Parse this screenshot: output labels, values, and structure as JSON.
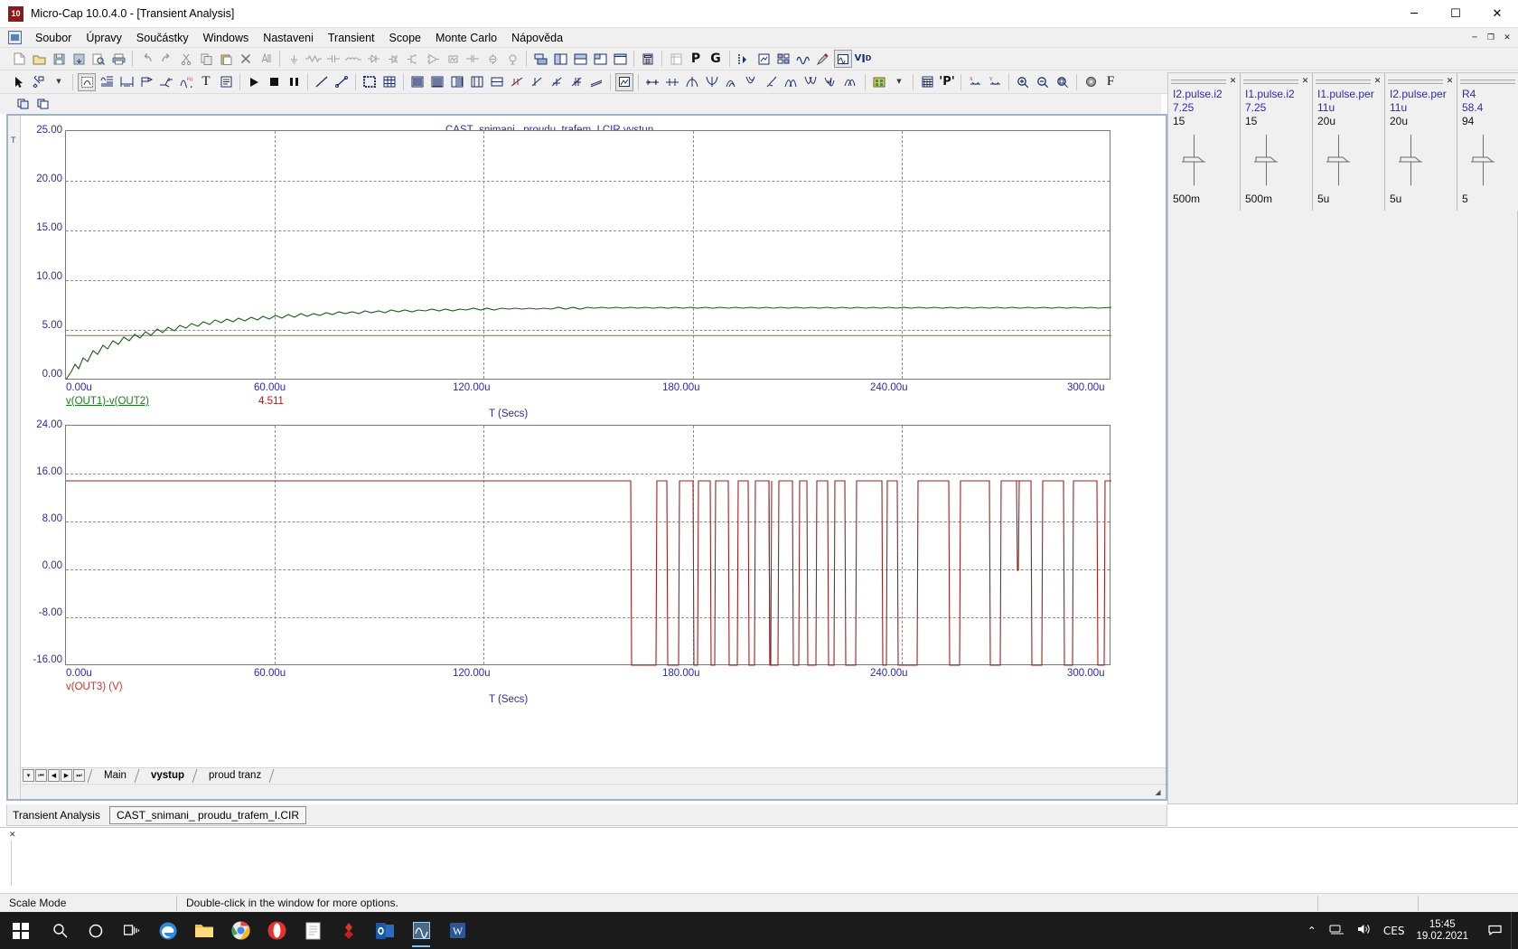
{
  "window": {
    "app_icon_label": "10",
    "title": "Micro-Cap 10.0.4.0 - [Transient Analysis]",
    "minimize": "─",
    "maximize": "☐",
    "close": "✕",
    "mdi_minimize": "─",
    "mdi_restore": "❐",
    "mdi_close": "✕"
  },
  "menu": {
    "items": [
      "Soubor",
      "Úpravy",
      "Součástky",
      "Windows",
      "Nastaveni",
      "Transient",
      "Scope",
      "Monte Carlo",
      "Nápověda"
    ]
  },
  "toolbar1": {
    "groups": [
      [
        "new-file-icon",
        "open-folder-icon",
        "save-icon",
        "save-all-icon",
        "print-preview-icon",
        "print-icon"
      ],
      [
        "undo-icon",
        "redo-icon",
        "cut-icon",
        "copy-icon",
        "paste-icon",
        "delete-icon",
        "select-all-icon"
      ],
      [
        "ground-icon",
        "resistor-icon",
        "capacitor-icon",
        "inductor-icon",
        "diode-icon",
        "jfet-icon",
        "transistor-icon",
        "opamp-icon",
        "source-icon",
        "node-icon",
        "probe-icon",
        "meter-icon"
      ],
      [
        "tile-icon",
        "split-vertical-icon",
        "split-horizontal-icon",
        "cascade-icon",
        "maximize-window-icon",
        "calculator-icon"
      ],
      [
        "table-icon",
        "p-label-icon",
        "g-label-icon"
      ],
      [
        "node-number-icon",
        "page-icon",
        "grid-values-icon",
        "waveform-icon",
        "marker-pen-icon",
        "circuit-window-icon",
        "vid-icon"
      ]
    ]
  },
  "toolbar2": {
    "groups": [
      [
        "arrow-select-icon",
        "component-icon",
        "dropdown-arrow-icon"
      ],
      [
        "wire-mode-icon",
        "text-graph-icon",
        "bus-icon",
        "flag-icon",
        "scale-icon",
        "function-icon",
        "text-icon",
        "properties-icon"
      ],
      [
        "run-icon",
        "stop-icon",
        "pause-icon"
      ],
      [
        "line-icon",
        "line-node-icon"
      ],
      [
        "box-icon",
        "grid-icon"
      ],
      [
        "bars-icon",
        "rows-icon",
        "columns-icon",
        "table2-icon",
        "window-icon",
        "cursor-mode-icon"
      ],
      [
        "peak-icon",
        "valley-icon",
        "highlow-icon",
        "slope-icon"
      ],
      [
        "thumbnail-icon"
      ],
      [
        "horiz-cursor-icon",
        "vert-cursor-icon",
        "peak-wave-icon",
        "valley-wave-icon",
        "rise-wave-icon",
        "fall-wave-icon",
        "slope-wave-icon",
        "inflection-wave-icon",
        "bottom-wave-icon",
        "global-wave-icon",
        "top-wave-icon"
      ],
      [
        "palette-icon",
        "palette-arrow-icon"
      ],
      [
        "numeric-output-icon"
      ],
      [
        "performance-p-icon"
      ],
      [
        "x-axis-icon",
        "y-axis-icon"
      ],
      [
        "zoom-in-icon",
        "zoom-out-icon",
        "zoom-fit-icon"
      ],
      [
        "color-wheel-icon",
        "font-f-icon"
      ]
    ]
  },
  "toolbar3": {
    "buttons": [
      "copy-window-icon",
      "paste-window-icon"
    ]
  },
  "plot_window": {
    "left_strip_mark": "T",
    "subtools": [
      "copy-plot-icon",
      "paste-plot-icon"
    ]
  },
  "page_tabs": {
    "nav": [
      "▾",
      "⏮",
      "◀",
      "▶",
      "⏭"
    ],
    "tabs": [
      {
        "label": "Main",
        "active": false
      },
      {
        "label": "vystup",
        "active": true
      },
      {
        "label": "proud tranz",
        "active": false
      }
    ]
  },
  "analysis_bar": {
    "label": "Transient Analysis",
    "file_tab": "CAST_snimani_ proudu_trafem_I.CIR"
  },
  "statusbar": {
    "mode": "Scale Mode",
    "hint": "Double-click in the window for more options."
  },
  "sliders": {
    "panels": [
      {
        "name": "I2.pulse.i2",
        "value": "7.25",
        "max": "15",
        "min": "500m",
        "close": "✕"
      },
      {
        "name": "I1.pulse.i2",
        "value": "7.25",
        "max": "15",
        "min": "500m",
        "close": "✕"
      },
      {
        "name": "I1.pulse.per",
        "value": "11u",
        "max": "20u",
        "min": "5u",
        "close": "✕"
      },
      {
        "name": "I2.pulse.per",
        "value": "11u",
        "max": "20u",
        "min": "5u",
        "close": "✕"
      },
      {
        "name": "R4",
        "value": "58.4",
        "max": "94",
        "min": "5",
        "close": "✕"
      }
    ]
  },
  "taskbar": {
    "start": "start-icon",
    "icons": [
      "search-icon",
      "cortana-icon",
      "task-view-icon",
      "edge-icon",
      "file-explorer-icon",
      "chrome-icon",
      "opera-icon",
      "notepad-icon",
      "mathcad-icon",
      "outlook-icon",
      "microcap-icon",
      "word-icon"
    ],
    "tray": {
      "chevron": "⌃",
      "network": "network-icon",
      "volume": "volume-icon",
      "language": "CES",
      "time": "15:45",
      "date": "19.02.2021",
      "notification": "notification-icon"
    }
  },
  "chart_data": [
    {
      "type": "line",
      "title": "CAST_snimani_ proudu_trafem_I.CIR vystup",
      "xlabel": "T (Secs)",
      "ylabel": "",
      "yticks": [
        "25.00",
        "20.00",
        "15.00",
        "10.00",
        "5.00",
        "0.00"
      ],
      "yvalues": [
        25,
        20,
        15,
        10,
        5,
        0
      ],
      "ylim": [
        0,
        25
      ],
      "xticks": [
        "0.00u",
        "60.00u",
        "120.00u",
        "180.00u",
        "240.00u",
        "300.00u"
      ],
      "xvalues": [
        0,
        60,
        120,
        180,
        240,
        300
      ],
      "xlim": [
        0,
        300
      ],
      "grid": true,
      "legend": [
        {
          "label": "v(OUT1)-v(OUT2)",
          "color": "#1e7a1e"
        },
        {
          "label": "4.511",
          "color": "#b01818"
        }
      ],
      "series": [
        {
          "name": "v(OUT1)-v(OUT2)",
          "color": "#1e5b1e",
          "x": [
            0,
            5,
            10,
            15,
            20,
            25,
            30,
            35,
            40,
            45,
            50,
            60,
            70,
            80,
            90,
            100,
            120,
            140,
            160,
            180,
            200,
            220,
            240,
            260,
            280,
            300
          ],
          "y": [
            0.0,
            1.35,
            2.05,
            2.55,
            2.9,
            3.2,
            3.42,
            3.6,
            3.75,
            3.88,
            3.98,
            4.12,
            4.23,
            4.31,
            4.36,
            4.4,
            4.45,
            4.48,
            4.5,
            4.51,
            4.51,
            4.51,
            4.51,
            4.51,
            4.51,
            4.51
          ]
        },
        {
          "name": "4.511",
          "color": "#b08030",
          "x": [
            0,
            300
          ],
          "y": [
            4.511,
            4.511
          ]
        }
      ]
    },
    {
      "type": "line",
      "title": "",
      "xlabel": "T (Secs)",
      "ylabel": "",
      "yticks": [
        "24.00",
        "16.00",
        "8.00",
        "0.00",
        "-8.00",
        "-16.00"
      ],
      "yvalues": [
        24,
        16,
        8,
        0,
        -8,
        -16
      ],
      "ylim": [
        -16,
        24
      ],
      "xticks": [
        "0.00u",
        "60.00u",
        "120.00u",
        "180.00u",
        "240.00u",
        "300.00u"
      ],
      "xvalues": [
        0,
        60,
        120,
        180,
        240,
        300
      ],
      "xlim": [
        0,
        300
      ],
      "grid": true,
      "legend": [
        {
          "label": "v(OUT3) (V)",
          "color": "#d03030"
        }
      ],
      "series": [
        {
          "name": "v(OUT3)",
          "color": "#a02020",
          "description": "Flat at ~14.8 V until ~162u, then a burst of narrow negative pulses down to -15 V between 162u and 295u",
          "baseline": 14.8,
          "low": -15.0,
          "pulse_start": 162,
          "pulse_end": 296,
          "pulses": [
            [
              163.5,
              170.5
            ],
            [
              173.5,
              176.5
            ],
            [
              180.0,
              181.2
            ],
            [
              183.3,
              184.5
            ],
            [
              187.0,
              189.5
            ],
            [
              192.5,
              194.0
            ],
            [
              196.5,
              199.0
            ],
            [
              201.5,
              203.0
            ],
            [
              205.5,
              208.0
            ],
            [
              210.5,
              212.0
            ],
            [
              215.0,
              218.0
            ],
            [
              222.5,
              223.5
            ],
            [
              226.0,
              231.5
            ],
            [
              235.5,
              238.5
            ],
            [
              244.5,
              247.5
            ],
            [
              253.5,
              256.5
            ],
            [
              262.5,
              265.0
            ],
            [
              271.5,
              273.5
            ],
            [
              280.5,
              281.5
            ],
            [
              289.0,
              290.0
            ]
          ]
        }
      ]
    }
  ]
}
